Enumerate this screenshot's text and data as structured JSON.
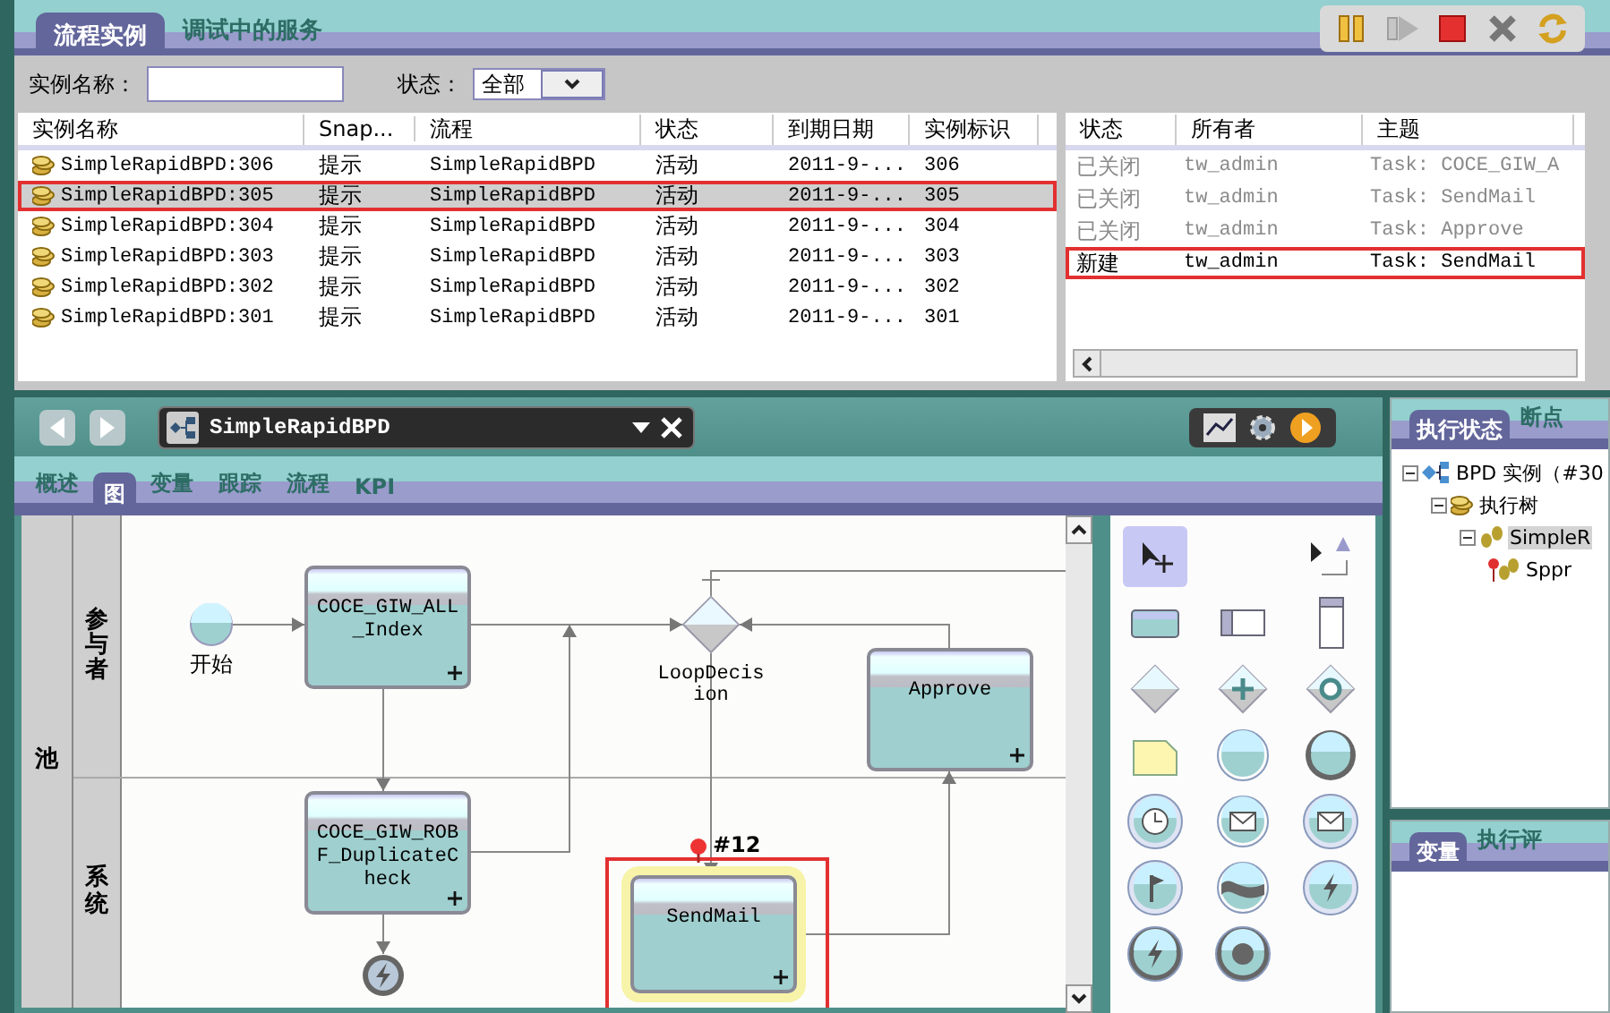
{
  "top_tabs": [
    {
      "label": "流程实例",
      "selected": true
    },
    {
      "label": "调试中的服务",
      "selected": false
    }
  ],
  "toolbar": [
    {
      "kind": "pause",
      "disabled": false
    },
    {
      "kind": "play",
      "disabled": true
    },
    {
      "kind": "stop",
      "disabled": false
    },
    {
      "kind": "close",
      "disabled": false
    },
    {
      "kind": "refresh",
      "disabled": false
    }
  ],
  "filter": {
    "name_label": "实例名称：",
    "state_label": "状态：",
    "state_value": "全部"
  },
  "instances": {
    "columns": [
      "实例名称",
      "Snap...",
      "流程",
      "状态",
      "到期日期",
      "实例标识"
    ],
    "rows": [
      {
        "cells": [
          "SimpleRapidBPD:306",
          "提示",
          "SimpleRapidBPD",
          "活动",
          "2011-9-...",
          "306"
        ],
        "selected": false,
        "highlighted": false
      },
      {
        "cells": [
          "SimpleRapidBPD:305",
          "提示",
          "SimpleRapidBPD",
          "活动",
          "2011-9-...",
          "305"
        ],
        "selected": true,
        "highlighted": true
      },
      {
        "cells": [
          "SimpleRapidBPD:304",
          "提示",
          "SimpleRapidBPD",
          "活动",
          "2011-9-...",
          "304"
        ],
        "selected": false,
        "highlighted": false
      },
      {
        "cells": [
          "SimpleRapidBPD:303",
          "提示",
          "SimpleRapidBPD",
          "活动",
          "2011-9-...",
          "303"
        ],
        "selected": false,
        "highlighted": false
      },
      {
        "cells": [
          "SimpleRapidBPD:302",
          "提示",
          "SimpleRapidBPD",
          "活动",
          "2011-9-...",
          "302"
        ],
        "selected": false,
        "highlighted": false
      },
      {
        "cells": [
          "SimpleRapidBPD:301",
          "提示",
          "SimpleRapidBPD",
          "活动",
          "2011-9-...",
          "301"
        ],
        "selected": false,
        "highlighted": false
      }
    ]
  },
  "tasks": {
    "columns": [
      "状态",
      "所有者",
      "主题"
    ],
    "rows": [
      {
        "cells": [
          "已关闭",
          "tw_admin",
          "Task: COCE_GIW_A"
        ],
        "closed": true,
        "highlighted": false
      },
      {
        "cells": [
          "已关闭",
          "tw_admin",
          "Task: SendMail"
        ],
        "closed": true,
        "highlighted": false
      },
      {
        "cells": [
          "已关闭",
          "tw_admin",
          "Task: Approve"
        ],
        "closed": true,
        "highlighted": false
      },
      {
        "cells": [
          "新建",
          "tw_admin",
          "Task: SendMail"
        ],
        "closed": false,
        "highlighted": true
      }
    ]
  },
  "editor": {
    "tab_title": "SimpleRapidBPD",
    "subtabs": [
      {
        "label": "概述",
        "selected": false
      },
      {
        "label": "图",
        "selected": true
      },
      {
        "label": "变量",
        "selected": false
      },
      {
        "label": "跟踪",
        "selected": false
      },
      {
        "label": "流程",
        "selected": false
      },
      {
        "label": "KPI",
        "selected": false
      }
    ]
  },
  "diagram": {
    "pool": "池",
    "lanes": [
      "参与者",
      "系统"
    ],
    "nodes": [
      {
        "kind": "start",
        "label": "开始",
        "highlighted": false
      },
      {
        "kind": "task",
        "label": "COCE_GIW_ALL_Index",
        "highlighted": false
      },
      {
        "kind": "gateway",
        "label": "LoopDecision",
        "highlighted": false
      },
      {
        "kind": "task",
        "label": "Approve",
        "highlighted": false
      },
      {
        "kind": "task",
        "label": "COCE_GIW_ROBF_DuplicateCheck",
        "highlighted": false
      },
      {
        "kind": "task",
        "label": "SendMail",
        "highlighted": true,
        "breakpoint": "#12"
      },
      {
        "kind": "end",
        "highlighted": false
      }
    ]
  },
  "palette": [
    {
      "kind": "pointer",
      "selected": true
    },
    {
      "kind": "connector",
      "selected": false
    },
    {
      "kind": "activity",
      "selected": false
    },
    {
      "kind": "lane",
      "selected": false
    },
    {
      "kind": "phase",
      "selected": false
    },
    {
      "kind": "gateway",
      "selected": false
    },
    {
      "kind": "parallel",
      "selected": false
    },
    {
      "kind": "inclusive",
      "selected": false
    },
    {
      "kind": "note",
      "selected": false
    },
    {
      "kind": "start",
      "selected": false
    },
    {
      "kind": "end",
      "selected": false
    },
    {
      "kind": "timer",
      "selected": false
    },
    {
      "kind": "message",
      "selected": false
    },
    {
      "kind": "catch",
      "selected": false
    },
    {
      "kind": "flag",
      "selected": false
    },
    {
      "kind": "wave",
      "selected": false
    },
    {
      "kind": "error",
      "selected": false
    },
    {
      "kind": "exception",
      "selected": false
    },
    {
      "kind": "terminate",
      "selected": false
    }
  ],
  "status_panel": {
    "tabs": [
      {
        "label": "执行状态",
        "selected": true
      },
      {
        "label": "断点",
        "selected": false
      }
    ],
    "tree": [
      {
        "kind": "instance",
        "label": "BPD 实例（#30",
        "selected": false,
        "children": [
          {
            "kind": "tree",
            "label": "执行树",
            "selected": false,
            "children": [
              {
                "kind": "step",
                "label": "SimpleR",
                "selected": true,
                "children": [
                  {
                    "kind": "breakpoint",
                    "label": "Sppr",
                    "selected": false
                  }
                ]
              }
            ]
          }
        ]
      }
    ]
  },
  "variables_panel": {
    "tabs": [
      {
        "label": "变量",
        "selected": true
      },
      {
        "label": "执行评",
        "selected": false
      }
    ]
  }
}
